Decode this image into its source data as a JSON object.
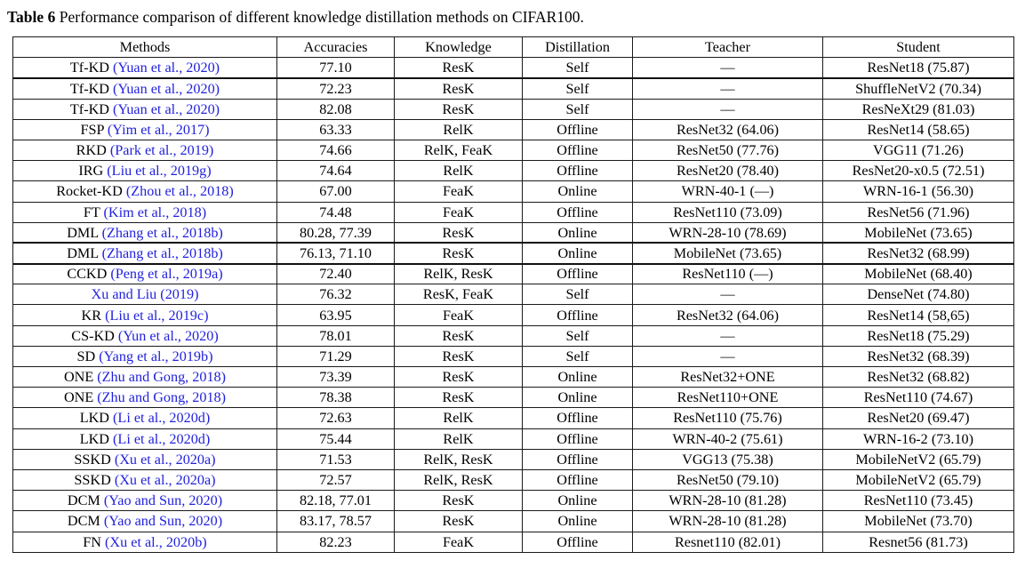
{
  "caption": {
    "label": "Table 6",
    "text": "Performance comparison of different knowledge distillation methods on CIFAR100."
  },
  "table": {
    "columns": [
      "Methods",
      "Accuracies",
      "Knowledge",
      "Distillation",
      "Teacher",
      "Student"
    ],
    "rows": [
      {
        "method_name": "Tf-KD",
        "method_cite": "(Yuan et al., 2020)",
        "accuracies": "77.10",
        "knowledge": "ResK",
        "distillation": "Self",
        "teacher": "—",
        "student": "ResNet18 (75.87)",
        "thick_below": true
      },
      {
        "method_name": "Tf-KD",
        "method_cite": "(Yuan et al., 2020)",
        "accuracies": "72.23",
        "knowledge": "ResK",
        "distillation": "Self",
        "teacher": "—",
        "student": "ShuffleNetV2 (70.34)",
        "thick_below": false
      },
      {
        "method_name": "Tf-KD",
        "method_cite": "(Yuan et al., 2020)",
        "accuracies": "82.08",
        "knowledge": "ResK",
        "distillation": "Self",
        "teacher": "—",
        "student": "ResNeXt29 (81.03)",
        "thick_below": false
      },
      {
        "method_name": "FSP",
        "method_cite": "(Yim et al., 2017)",
        "accuracies": "63.33",
        "knowledge": "RelK",
        "distillation": "Offline",
        "teacher": "ResNet32 (64.06)",
        "student": "ResNet14 (58.65)",
        "thick_below": false
      },
      {
        "method_name": "RKD",
        "method_cite": "(Park et al., 2019)",
        "accuracies": "74.66",
        "knowledge": "RelK, FeaK",
        "distillation": "Offline",
        "teacher": "ResNet50 (77.76)",
        "student": "VGG11 (71.26)",
        "thick_below": false
      },
      {
        "method_name": "IRG",
        "method_cite": "(Liu et al., 2019g)",
        "accuracies": "74.64",
        "knowledge": "RelK",
        "distillation": "Offline",
        "teacher": "ResNet20 (78.40)",
        "student": "ResNet20-x0.5 (72.51)",
        "thick_below": false
      },
      {
        "method_name": "Rocket-KD",
        "method_cite": "(Zhou et al., 2018)",
        "accuracies": "67.00",
        "knowledge": "FeaK",
        "distillation": "Online",
        "teacher": "WRN-40-1 (—)",
        "student": "WRN-16-1 (56.30)",
        "thick_below": false
      },
      {
        "method_name": "FT",
        "method_cite": "(Kim et al., 2018)",
        "accuracies": "74.48",
        "knowledge": "FeaK",
        "distillation": "Offline",
        "teacher": "ResNet110 (73.09)",
        "student": "ResNet56 (71.96)",
        "thick_below": false
      },
      {
        "method_name": "DML",
        "method_cite": "(Zhang et al., 2018b)",
        "accuracies": "80.28, 77.39",
        "knowledge": "ResK",
        "distillation": "Online",
        "teacher": "WRN-28-10 (78.69)",
        "student": "MobileNet (73.65)",
        "thick_below": true
      },
      {
        "method_name": "DML",
        "method_cite": "(Zhang et al., 2018b)",
        "accuracies": "76.13, 71.10",
        "knowledge": "ResK",
        "distillation": "Online",
        "teacher": "MobileNet (73.65)",
        "student": "ResNet32 (68.99)",
        "thick_below": true
      },
      {
        "method_name": "CCKD",
        "method_cite": "(Peng et al., 2019a)",
        "accuracies": "72.40",
        "knowledge": "RelK, ResK",
        "distillation": "Offline",
        "teacher": "ResNet110 (—)",
        "student": "MobileNet (68.40)",
        "thick_below": false
      },
      {
        "method_name": "",
        "method_cite": "Xu and Liu (2019)",
        "method_all_blue": true,
        "accuracies": "76.32",
        "knowledge": "ResK, FeaK",
        "distillation": "Self",
        "teacher": "—",
        "student": "DenseNet (74.80)",
        "thick_below": false
      },
      {
        "method_name": "KR",
        "method_cite": "(Liu et al., 2019c)",
        "accuracies": "63.95",
        "knowledge": "FeaK",
        "distillation": "Offline",
        "teacher": "ResNet32 (64.06)",
        "student": "ResNet14 (58,65)",
        "thick_below": false
      },
      {
        "method_name": "CS-KD",
        "method_cite": "(Yun et al., 2020)",
        "accuracies": "78.01",
        "knowledge": "ResK",
        "distillation": "Self",
        "teacher": "—",
        "student": "ResNet18 (75.29)",
        "thick_below": false
      },
      {
        "method_name": "SD",
        "method_cite": "(Yang et al., 2019b)",
        "accuracies": "71.29",
        "knowledge": "ResK",
        "distillation": "Self",
        "teacher": "—",
        "student": "ResNet32 (68.39)",
        "thick_below": false
      },
      {
        "method_name": "ONE",
        "method_cite": "(Zhu and Gong, 2018)",
        "accuracies": "73.39",
        "knowledge": "ResK",
        "distillation": "Online",
        "teacher": "ResNet32+ONE",
        "student": "ResNet32 (68.82)",
        "thick_below": false
      },
      {
        "method_name": "ONE",
        "method_cite": "(Zhu and Gong, 2018)",
        "accuracies": "78.38",
        "knowledge": "ResK",
        "distillation": "Online",
        "teacher": "ResNet110+ONE",
        "student": "ResNet110 (74.67)",
        "thick_below": false
      },
      {
        "method_name": "LKD",
        "method_cite": "(Li et al., 2020d)",
        "accuracies": "72.63",
        "knowledge": "RelK",
        "distillation": "Offline",
        "teacher": "ResNet110 (75.76)",
        "student": "ResNet20 (69.47)",
        "thick_below": false
      },
      {
        "method_name": "LKD",
        "method_cite": "(Li et al., 2020d)",
        "accuracies": "75.44",
        "knowledge": "RelK",
        "distillation": "Offline",
        "teacher": "WRN-40-2 (75.61)",
        "student": "WRN-16-2 (73.10)",
        "thick_below": false
      },
      {
        "method_name": "SSKD",
        "method_cite": "(Xu et al., 2020a)",
        "accuracies": "71.53",
        "knowledge": "RelK, ResK",
        "distillation": "Offline",
        "teacher": "VGG13 (75.38)",
        "student": "MobileNetV2 (65.79)",
        "thick_below": false
      },
      {
        "method_name": "SSKD",
        "method_cite": "(Xu et al., 2020a)",
        "accuracies": "72.57",
        "knowledge": "RelK, ResK",
        "distillation": "Offline",
        "teacher": "ResNet50 (79.10)",
        "student": "MobileNetV2 (65.79)",
        "thick_below": false
      },
      {
        "method_name": "DCM",
        "method_cite": "(Yao and Sun, 2020)",
        "accuracies": "82.18, 77.01",
        "knowledge": "ResK",
        "distillation": "Online",
        "teacher": "WRN-28-10 (81.28)",
        "student": "ResNet110 (73.45)",
        "thick_below": false
      },
      {
        "method_name": "DCM",
        "method_cite": "(Yao and Sun, 2020)",
        "accuracies": "83.17, 78.57",
        "knowledge": "ResK",
        "distillation": "Online",
        "teacher": "WRN-28-10 (81.28)",
        "student": "MobileNet (73.70)",
        "thick_below": false
      },
      {
        "method_name": "FN",
        "method_cite": "(Xu et al., 2020b)",
        "accuracies": "82.23",
        "knowledge": "FeaK",
        "distillation": "Offline",
        "teacher": "Resnet110 (82.01)",
        "student": "Resnet56 (81.73)",
        "thick_below": false
      }
    ]
  },
  "colors": {
    "citation_blue": "#2222dd",
    "rule": "#1a1a1a",
    "text": "#000000"
  }
}
